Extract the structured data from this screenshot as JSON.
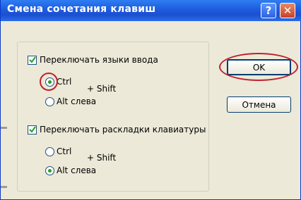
{
  "window": {
    "title": "Смена сочетания клавиш",
    "help_glyph": "?",
    "close_glyph": "✕"
  },
  "group": {
    "input_lang": {
      "label": "Переключать языки ввода",
      "checked": true,
      "ctrl_label": "Ctrl",
      "alt_label": "Alt слева",
      "shift_label": "+ Shift",
      "selected": "Ctrl"
    },
    "layout": {
      "label": "Переключать раскладки клавиатуры",
      "checked": true,
      "ctrl_label": "Ctrl",
      "alt_label": "Alt слева",
      "shift_label": "+ Shift",
      "selected": "Alt слева"
    }
  },
  "buttons": {
    "ok": "OK",
    "cancel": "Отмена"
  },
  "colors": {
    "title_bar": "#1f5fe0",
    "annotation": "#c0202e",
    "dialog_bg": "#ece9d8"
  }
}
